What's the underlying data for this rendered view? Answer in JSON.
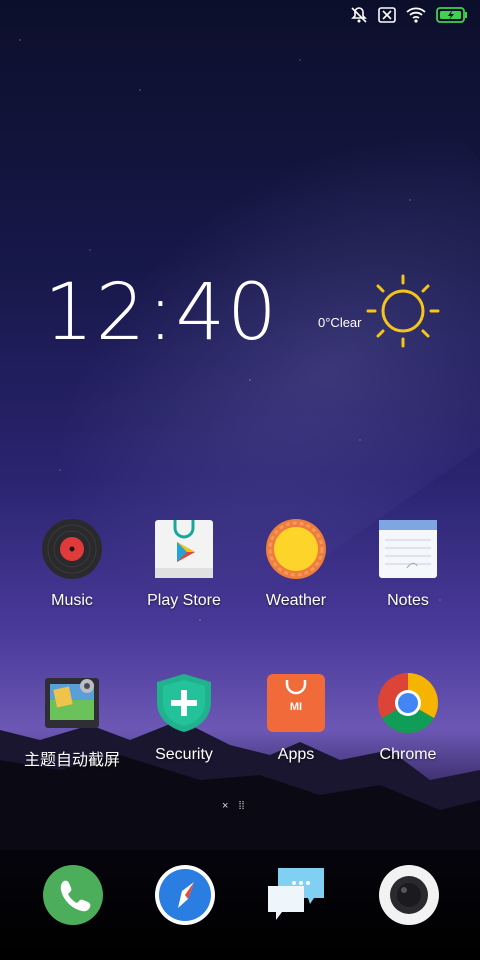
{
  "status_bar": {
    "icons": [
      "alarm-off-icon",
      "no-sim-icon",
      "wifi-icon",
      "battery-charging-icon"
    ]
  },
  "clock": {
    "time": "12:40"
  },
  "weather": {
    "text": "0°Clear",
    "icon": "sun-icon",
    "color": "#f5c518"
  },
  "apps": [
    {
      "id": "music",
      "label": "Music",
      "icon": "vinyl-record-icon"
    },
    {
      "id": "play-store",
      "label": "Play Store",
      "icon": "play-store-icon"
    },
    {
      "id": "weather",
      "label": "Weather",
      "icon": "weather-sun-icon"
    },
    {
      "id": "notes",
      "label": "Notes",
      "icon": "notepad-icon"
    },
    {
      "id": "theme-screenshot",
      "label": "主题自动截屏",
      "icon": "photo-frame-icon"
    },
    {
      "id": "security",
      "label": "Security",
      "icon": "shield-plus-icon"
    },
    {
      "id": "apps",
      "label": "Apps",
      "icon": "shopping-bag-icon"
    },
    {
      "id": "chrome",
      "label": "Chrome",
      "icon": "chrome-icon"
    }
  ],
  "page_indicator": {
    "items": [
      "×",
      "⁞⁞"
    ]
  },
  "dock": [
    {
      "id": "phone",
      "icon": "phone-icon",
      "color": "#4cae5a"
    },
    {
      "id": "browser",
      "icon": "compass-icon",
      "color": "#2a7de1"
    },
    {
      "id": "messaging",
      "icon": "chat-bubbles-icon",
      "color": "#7fd0f2"
    },
    {
      "id": "camera",
      "icon": "camera-lens-icon",
      "color": "#f2f2f2"
    }
  ]
}
